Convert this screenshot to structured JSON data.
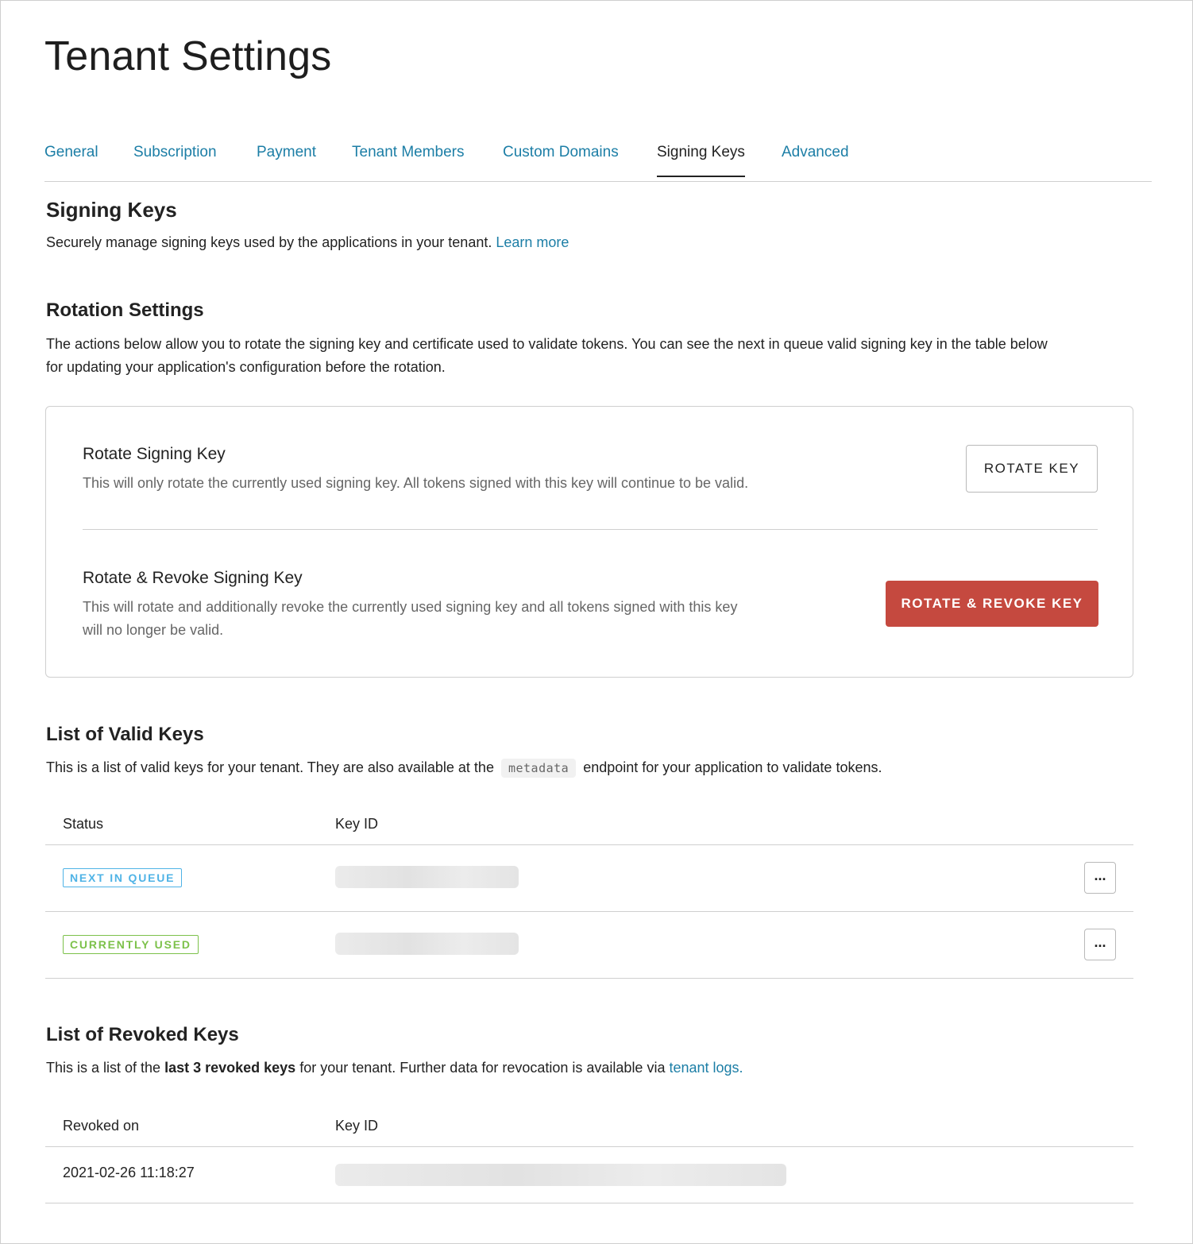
{
  "page": {
    "title": "Tenant Settings"
  },
  "tabs": [
    {
      "label": "General"
    },
    {
      "label": "Subscription"
    },
    {
      "label": "Payment"
    },
    {
      "label": "Tenant Members"
    },
    {
      "label": "Custom Domains"
    },
    {
      "label": "Signing Keys",
      "active": true
    },
    {
      "label": "Advanced"
    }
  ],
  "signing_keys": {
    "heading": "Signing Keys",
    "description": "Securely manage signing keys used by the applications in your tenant.",
    "learn_more": "Learn more"
  },
  "rotation": {
    "heading": "Rotation Settings",
    "description_line1": "The actions below allow you to rotate the signing key and certificate used to validate tokens. You can see the next in queue valid signing key in the table below",
    "description_line2": "for updating your application's configuration before the rotation.",
    "rotate": {
      "title": "Rotate Signing Key",
      "description": "This will only rotate the currently used signing key. All tokens signed with this key will continue to be valid.",
      "button": "ROTATE KEY"
    },
    "rotate_revoke": {
      "title": "Rotate & Revoke Signing Key",
      "description_line1": "This will rotate and additionally revoke the currently used signing key and all tokens signed with this key",
      "description_line2": "will no longer be valid.",
      "button": "ROTATE & REVOKE KEY"
    }
  },
  "valid_keys": {
    "heading": "List of Valid Keys",
    "desc_before": "This is a list of valid keys for your tenant. They are also available at the",
    "code": "metadata",
    "desc_after": "endpoint for your application to validate tokens.",
    "columns": {
      "status": "Status",
      "key_id": "Key ID"
    },
    "rows": [
      {
        "status": "NEXT IN QUEUE",
        "status_color": "#4fb3e6",
        "more": "..."
      },
      {
        "status": "CURRENTLY USED",
        "status_color": "#7cc14a",
        "more": "..."
      }
    ]
  },
  "revoked_keys": {
    "heading": "List of Revoked Keys",
    "desc_before": "This is a list of the",
    "desc_bold": "last 3 revoked keys",
    "desc_middle": "for your tenant. Further data for revocation is available via",
    "desc_link": "tenant logs.",
    "columns": {
      "revoked_on": "Revoked on",
      "key_id": "Key ID"
    },
    "rows": [
      {
        "revoked_on": "2021-02-26 11:18:27"
      }
    ]
  },
  "colors": {
    "link": "#1c7ea6",
    "danger": "#c5493f",
    "badge_next": "#4fb3e6",
    "badge_current": "#7cc14a"
  }
}
